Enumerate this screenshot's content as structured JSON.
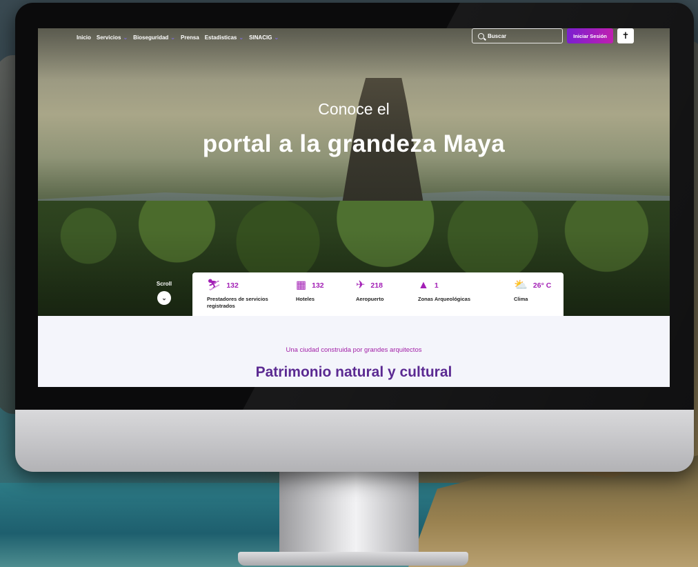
{
  "nav": {
    "items": [
      {
        "label": "Inicio",
        "dropdown": false
      },
      {
        "label": "Servicios",
        "dropdown": true
      },
      {
        "label": "Bioseguridad",
        "dropdown": true
      },
      {
        "label": "Prensa",
        "dropdown": false
      },
      {
        "label": "Estadisticas",
        "dropdown": true
      },
      {
        "label": "SINACIG",
        "dropdown": true
      }
    ],
    "search_placeholder": "Buscar",
    "login_label": "Iniciar Sesión",
    "accessibility_icon": "accessibility-person-icon"
  },
  "hero": {
    "line1": "Conoce el",
    "line2": "portal a la grandeza Maya",
    "scroll_label": "Scroll"
  },
  "stats": [
    {
      "icon": "guide-person-icon",
      "value": "132",
      "label": "Prestadores de servicios registrados"
    },
    {
      "icon": "hotel-building-icon",
      "value": "132",
      "label": "Hoteles"
    },
    {
      "icon": "airplane-icon",
      "value": "218",
      "label": "Aeropuerto"
    },
    {
      "icon": "pyramid-icon",
      "value": "1",
      "label": "Zonas Arqueológicas"
    },
    {
      "icon": "sun-cloud-icon",
      "value": "26° C",
      "label": "Clima"
    }
  ],
  "section": {
    "kicker": "Una ciudad construida por grandes arquitectos",
    "title": "Patrimonio natural y cultural"
  },
  "colors": {
    "accent_magenta": "#a21fb5",
    "title_purple": "#5b2a92",
    "login_gradient_start": "#7a1fd0",
    "login_gradient_end": "#c01fb0"
  }
}
